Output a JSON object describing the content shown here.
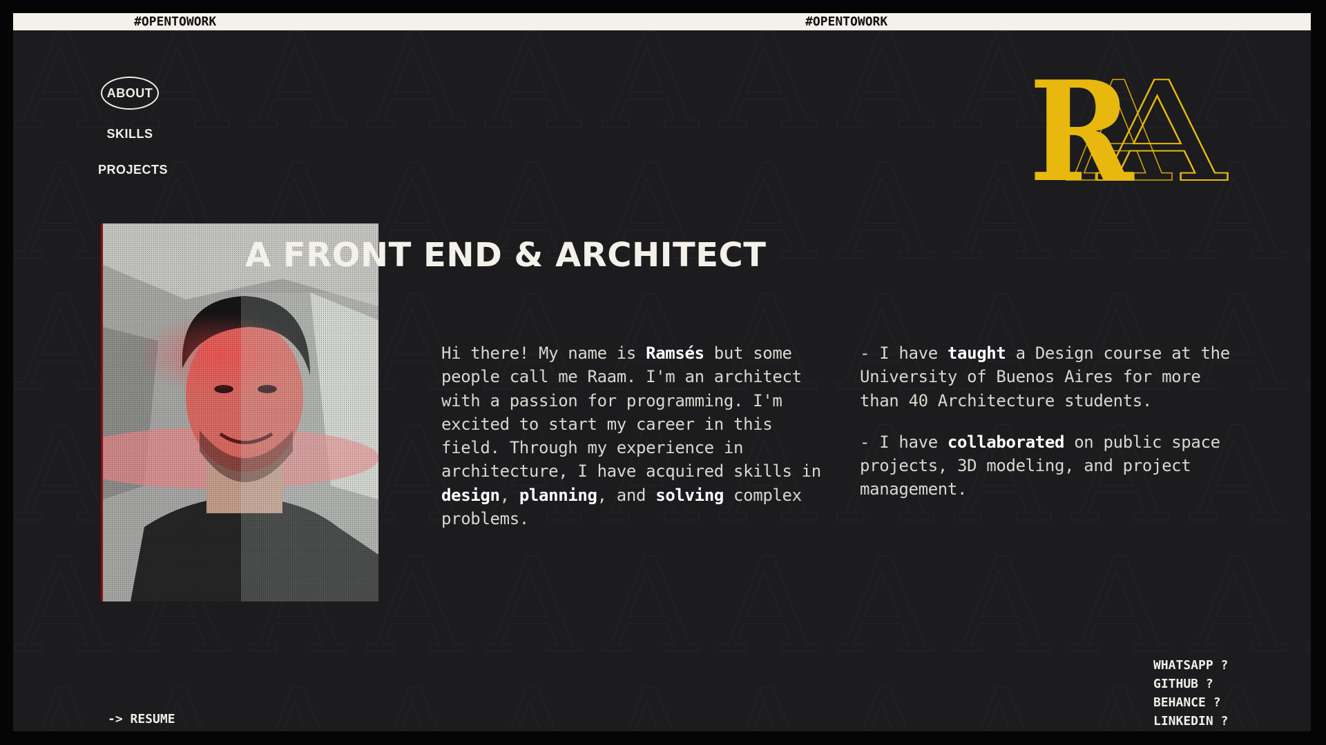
{
  "ticker": {
    "left_text": "#OPENTOWORK",
    "right_text": "#OPENTOWORK"
  },
  "nav": {
    "about": "ABOUT",
    "skills": "SKILLS",
    "projects": "PROJECTS"
  },
  "logo": {
    "letters": "RA",
    "color": "#e8b80e"
  },
  "headline": "A FRONT END & ARCHITECT",
  "bio": {
    "p1": "Hi there! My name is ",
    "name": "Ramsés",
    "p2": " but some people call me Raam. I'm an architect with a passion for programming. I'm excited to start my career in this field. Through my experience in architecture, I have acquired skills in ",
    "skill1": "design",
    "sep1": ", ",
    "skill2": "planning",
    "sep2": ", and ",
    "skill3": "solving",
    "p3": " complex problems."
  },
  "facts": {
    "f1_pre": "- I have ",
    "f1_bold": "taught",
    "f1_post": " a Design course at the University of Buenos Aires for more than 40 Architecture students.",
    "f2_pre": "- I have ",
    "f2_bold": "collaborated",
    "f2_post": " on public space projects, 3D modeling, and project management."
  },
  "resume": "-> RESUME",
  "socials": [
    "WHATSAPP ?",
    "GITHUB ?",
    "BEHANCE ?",
    "LINKEDIN ?"
  ],
  "colors": {
    "background": "#1c1c1e",
    "accent_yellow": "#e8b80e",
    "accent_red": "#d62828",
    "text": "#e8e6df"
  }
}
